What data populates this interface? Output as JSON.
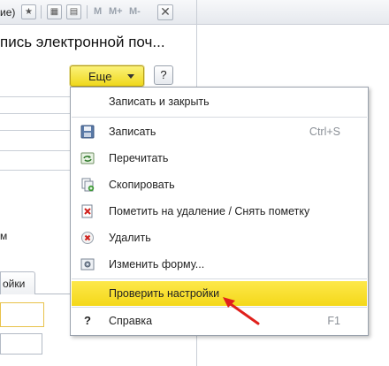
{
  "window": {
    "title_fragment": "ие)",
    "toolbar": {
      "m_label": "M",
      "mplus_label": "M+",
      "mminus_label": "M-"
    },
    "close_glyph": "✕"
  },
  "page_title": "пись электронной поч...",
  "more_button_label": "Еще",
  "help_button_label": "?",
  "background": {
    "label_fragment": "м",
    "tab_label_fragment": "ойки"
  },
  "menu": {
    "items": [
      {
        "label": "Записать и закрыть",
        "icon": "",
        "shortcut": ""
      },
      {
        "label": "Записать",
        "icon": "save-icon",
        "shortcut": "Ctrl+S"
      },
      {
        "label": "Перечитать",
        "icon": "reload-icon",
        "shortcut": ""
      },
      {
        "label": "Скопировать",
        "icon": "copy-icon",
        "shortcut": ""
      },
      {
        "label": "Пометить на удаление / Снять пометку",
        "icon": "mark-delete-icon",
        "shortcut": ""
      },
      {
        "label": "Удалить",
        "icon": "delete-icon",
        "shortcut": ""
      },
      {
        "label": "Изменить форму...",
        "icon": "form-settings-icon",
        "shortcut": ""
      },
      {
        "label": "Проверить настройки",
        "icon": "",
        "shortcut": ""
      },
      {
        "label": "Справка",
        "icon": "help-icon",
        "shortcut": "F1"
      }
    ],
    "help_glyph": "?"
  },
  "colors": {
    "highlight": "#f4d81a",
    "more_button": "#efd81c",
    "annotation_arrow": "#e0201c"
  }
}
